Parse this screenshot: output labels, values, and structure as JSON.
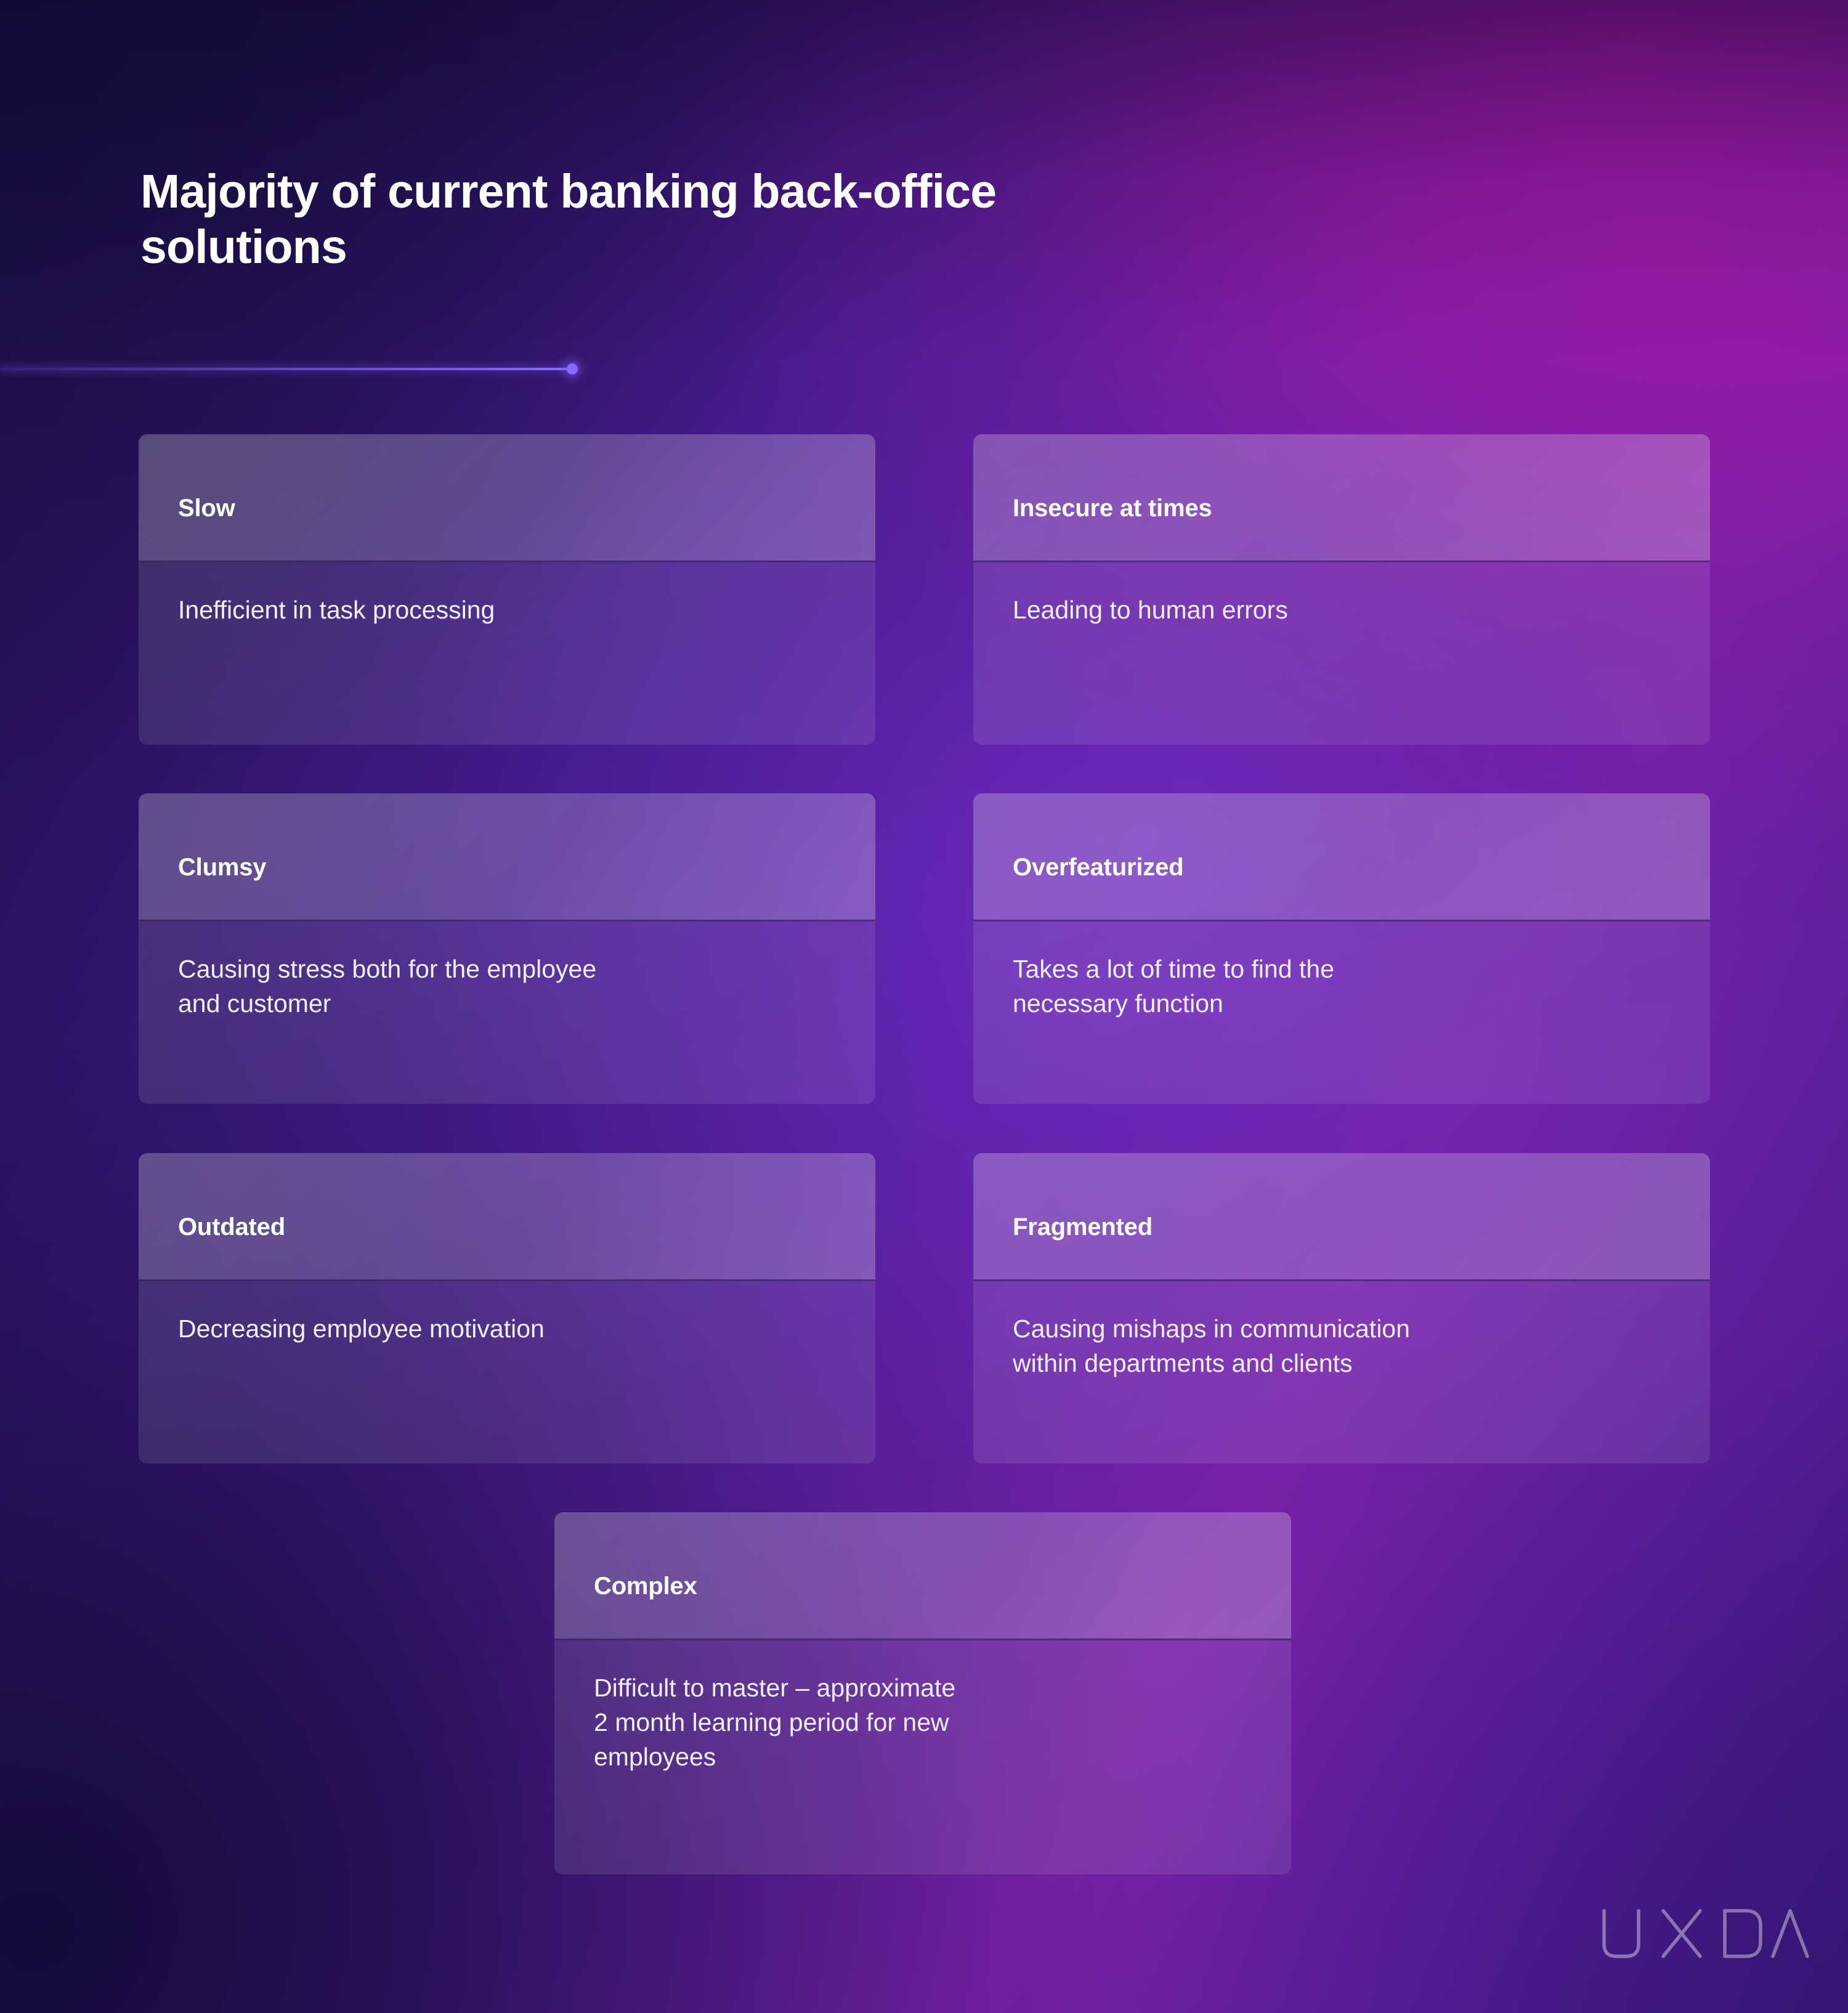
{
  "slide": {
    "headline": "Majority of current banking back-office\nsolutions",
    "accent_color": "#8a68ff",
    "text_color": "#ffffff",
    "background_colors": {
      "top_left": "#221050",
      "top_right": "#9620a8",
      "bottom_left": "#1d1140",
      "bottom_right": "#45218b"
    }
  },
  "cards": [
    {
      "title": "Slow",
      "description": "Inefficient in task processing"
    },
    {
      "title": "Insecure at times",
      "description": "Leading to human errors"
    },
    {
      "title": "Clumsy",
      "description": "Causing stress both for the employee\nand customer"
    },
    {
      "title": "Overfeaturized",
      "description": "Takes a lot of time to find the\nnecessary function"
    },
    {
      "title": "Outdated",
      "description": "Decreasing employee motivation"
    },
    {
      "title": "Fragmented",
      "description": "Causing mishaps in communication\nwithin departments and clients"
    },
    {
      "title": "Complex",
      "description": "Difficult to master – approximate\n2 month learning period for new\nemployees"
    }
  ],
  "footer": {
    "logo_text": "UXDA"
  }
}
